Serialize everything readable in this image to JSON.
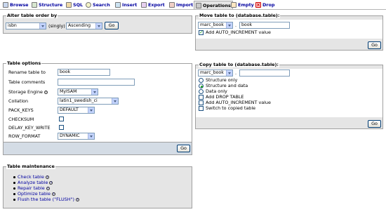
{
  "tabs": [
    {
      "label": "Browse",
      "icon": "browse-icon",
      "active": false
    },
    {
      "label": "Structure",
      "icon": "structure-icon",
      "active": false
    },
    {
      "label": "SQL",
      "icon": "sql-icon",
      "active": false
    },
    {
      "label": "Search",
      "icon": "search-icon",
      "active": false
    },
    {
      "label": "Insert",
      "icon": "insert-icon",
      "active": false
    },
    {
      "label": "Export",
      "icon": "export-icon",
      "active": false
    },
    {
      "label": "Import",
      "icon": "import-icon",
      "active": false
    },
    {
      "label": "Operations",
      "icon": "operations-icon",
      "active": true
    },
    {
      "label": "Empty",
      "icon": "empty-icon",
      "active": false
    },
    {
      "label": "Drop",
      "icon": "drop-icon",
      "active": false
    }
  ],
  "alter_order": {
    "legend": "Alter table order by",
    "column_value": "isbn",
    "singly_label": "(singly)",
    "direction_value": "Ascending",
    "go_label": "Go"
  },
  "move_table": {
    "legend": "Move table to (database.table):",
    "database_value": "marc_book",
    "separator": ".",
    "table_value": "book",
    "auto_increment_label": "Add AUTO_INCREMENT value",
    "auto_increment_checked": true,
    "go_label": "Go"
  },
  "table_options": {
    "legend": "Table options",
    "rename_label": "Rename table to",
    "rename_value": "book",
    "comments_label": "Table comments",
    "comments_value": "",
    "engine_label": "Storage Engine",
    "engine_value": "MyISAM",
    "collation_label": "Collation",
    "collation_value": "latin1_swedish_ci",
    "pack_keys_label": "PACK_KEYS",
    "pack_keys_value": "DEFAULT",
    "checksum_label": "CHECKSUM",
    "delay_key_write_label": "DELAY_KEY_WRITE",
    "row_format_label": "ROW_FORMAT",
    "row_format_value": "DYNAMIC",
    "go_label": "Go"
  },
  "copy_table": {
    "legend": "Copy table to (database.table):",
    "database_value": "marc_book",
    "separator": ".",
    "table_value": "",
    "options": [
      {
        "label": "Structure only",
        "type": "radio",
        "checked": false
      },
      {
        "label": "Structure and data",
        "type": "radio",
        "checked": true
      },
      {
        "label": "Data only",
        "type": "radio",
        "checked": false
      },
      {
        "label": "Add DROP TABLE",
        "type": "checkbox",
        "checked": false
      },
      {
        "label": "Add AUTO_INCREMENT value",
        "type": "checkbox",
        "checked": false
      },
      {
        "label": "Switch to copied table",
        "type": "checkbox",
        "checked": false
      }
    ],
    "go_label": "Go"
  },
  "maintenance": {
    "legend": "Table maintenance",
    "items": [
      "Check table",
      "Analyze table",
      "Repair table",
      "Optimize table",
      "Flush the table (\"FLUSH\")"
    ]
  }
}
